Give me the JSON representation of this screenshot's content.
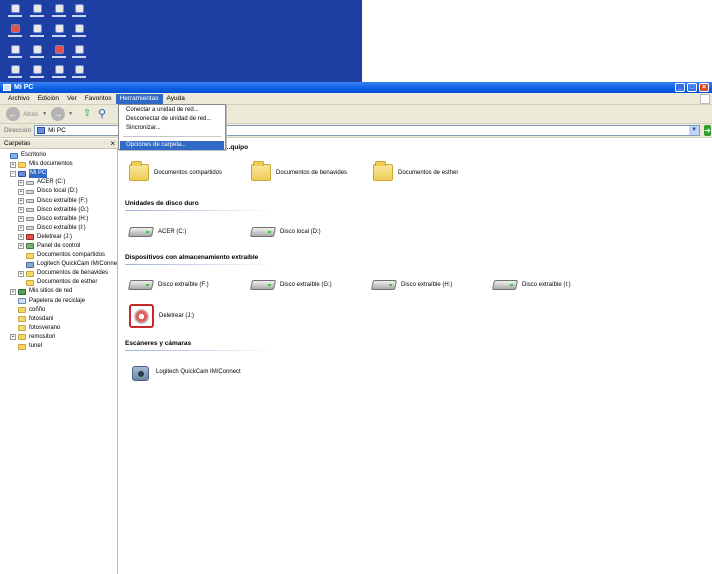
{
  "window": {
    "title": "Mi PC"
  },
  "desktop": {
    "icons": [
      "app-icon",
      "app-icon",
      "app-icon",
      "app-icon",
      "app-icon",
      "app-icon",
      "app-icon",
      "app-icon",
      "app-icon",
      "app-icon",
      "app-icon",
      "app-icon",
      "app-icon",
      "app-icon",
      "app-icon",
      "app-icon"
    ]
  },
  "menubar": {
    "items": [
      "Archivo",
      "Edición",
      "Ver",
      "Favoritos",
      "Herramientas",
      "Ayuda"
    ],
    "active": "Herramientas"
  },
  "toolbar": {
    "back_label": "Atrás"
  },
  "address": {
    "label": "Dirección",
    "value": "Mi PC"
  },
  "tools_menu": {
    "items": [
      "Conectar a unidad de red...",
      "Desconectar de unidad de red...",
      "Sincronizar...",
      "Opciones de carpeta..."
    ],
    "highlighted": "Opciones de carpeta..."
  },
  "left_panel": {
    "title": "Carpetas",
    "close": "×",
    "tree": [
      {
        "label": "Escritorio",
        "icon": "desktop-icon",
        "expander": "",
        "indent": 0
      },
      {
        "label": "Mis documentos",
        "icon": "folder-icon",
        "expander": "+",
        "indent": 1
      },
      {
        "label": "Mi PC",
        "icon": "computer-icon",
        "expander": "−",
        "indent": 1,
        "selected": true
      },
      {
        "label": "ACER (C:)",
        "icon": "drive-icon",
        "expander": "+",
        "indent": 2
      },
      {
        "label": "Disco local (D:)",
        "icon": "drive-icon",
        "expander": "+",
        "indent": 2
      },
      {
        "label": "Disco extraíble (F:)",
        "icon": "drive-icon",
        "expander": "+",
        "indent": 2
      },
      {
        "label": "Disco extraíble (G:)",
        "icon": "drive-icon",
        "expander": "+",
        "indent": 2
      },
      {
        "label": "Disco extraíble (H:)",
        "icon": "drive-icon",
        "expander": "+",
        "indent": 2
      },
      {
        "label": "Disco extraíble (I:)",
        "icon": "drive-icon",
        "expander": "+",
        "indent": 2
      },
      {
        "label": "Deletrear (J:)",
        "icon": "dvd-icon",
        "expander": "+",
        "indent": 2
      },
      {
        "label": "Panel de control",
        "icon": "control-panel-icon",
        "expander": "+",
        "indent": 2
      },
      {
        "label": "Documentos compartidos",
        "icon": "folder-icon",
        "expander": "",
        "indent": 2
      },
      {
        "label": "Logitech QuickCam IM/Conne",
        "icon": "camera-icon",
        "expander": "",
        "indent": 2
      },
      {
        "label": "Documentos de benavides",
        "icon": "folder-icon",
        "expander": "+",
        "indent": 2
      },
      {
        "label": "Documentos de esther",
        "icon": "folder-icon",
        "expander": "",
        "indent": 2
      },
      {
        "label": "Mis sitios de red",
        "icon": "network-icon",
        "expander": "+",
        "indent": 1
      },
      {
        "label": "Papelera de reciclaje",
        "icon": "recycle-bin-icon",
        "expander": "",
        "indent": 1
      },
      {
        "label": "coñño",
        "icon": "folder-icon",
        "expander": "",
        "indent": 1
      },
      {
        "label": "fotosdani",
        "icon": "folder-icon",
        "expander": "",
        "indent": 1
      },
      {
        "label": "fotosverano",
        "icon": "folder-icon",
        "expander": "",
        "indent": 1
      },
      {
        "label": "remositori",
        "icon": "folder-icon",
        "expander": "+",
        "indent": 1
      },
      {
        "label": "tunel",
        "icon": "folder-icon",
        "expander": "",
        "indent": 1
      }
    ]
  },
  "main": {
    "groups": [
      {
        "title": "...quipo",
        "items": [
          "Documentos compartidos",
          "Documentos de benavides",
          "Documentos de esther"
        ]
      },
      {
        "title": "Unidades de disco duro",
        "items": [
          "ACER (C:)",
          "Disco local (D:)"
        ]
      },
      {
        "title": "Dispositivos con almacenamiento extraíble",
        "items": [
          "Disco extraíble (F:)",
          "Disco extraíble (G:)",
          "Disco extraíble (H:)",
          "Disco extraíble (I:)",
          "Deletrear (J:)"
        ]
      },
      {
        "title": "Escáneres y cámaras",
        "items": [
          "Logitech QuickCam IM/Connect"
        ]
      }
    ]
  },
  "colors": {
    "titlebar": "#0a5ee6",
    "selection": "#316ac5",
    "chrome": "#ece9d8",
    "desktop": "#1d3fa3"
  }
}
